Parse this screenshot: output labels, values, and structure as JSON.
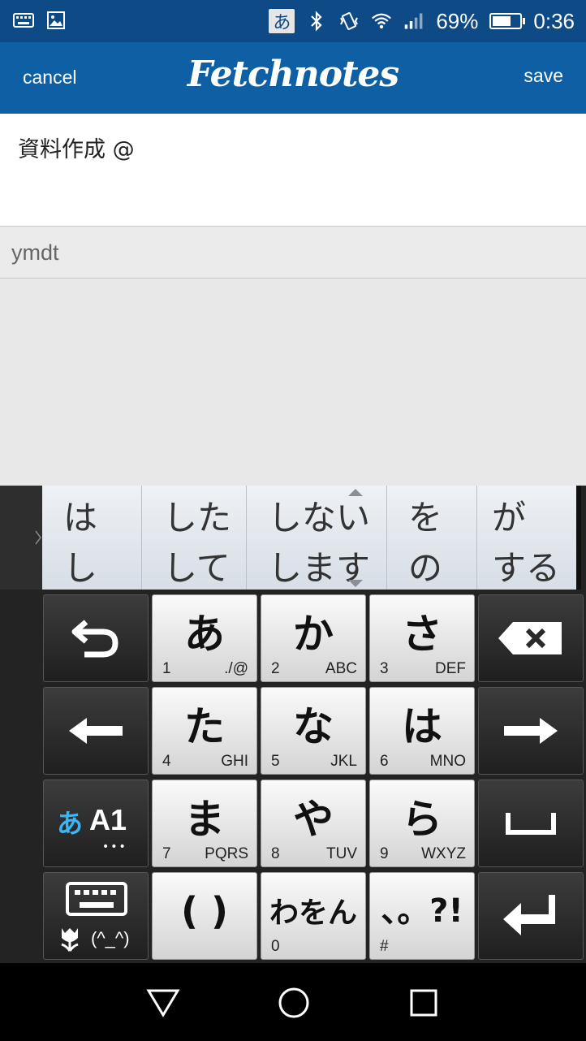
{
  "status_bar": {
    "icons_left": [
      "keyboard-icon",
      "image-icon"
    ],
    "ime_label": "あ",
    "icons_right": [
      "bluetooth-icon",
      "vibrate-icon",
      "wifi-icon",
      "signal-icon"
    ],
    "battery_percent": "69%",
    "battery_level": 0.69,
    "time": "0:36"
  },
  "header": {
    "cancel_label": "cancel",
    "logo": "Fetchnotes",
    "save_label": "save",
    "color": "#0e5fa4"
  },
  "note": {
    "text": "資料作成  @"
  },
  "tag_row": {
    "text": "ymdt"
  },
  "candidates": [
    {
      "top": "は",
      "bottom": "し"
    },
    {
      "top": "した",
      "bottom": "して"
    },
    {
      "top": "しない",
      "bottom": "します"
    },
    {
      "top": "を",
      "bottom": "の"
    },
    {
      "top": "が",
      "bottom": "する"
    }
  ],
  "keys": {
    "a": {
      "kana": "あ",
      "num": "1",
      "alpha": "./@"
    },
    "ka": {
      "kana": "か",
      "num": "2",
      "alpha": "ABC"
    },
    "sa": {
      "kana": "さ",
      "num": "3",
      "alpha": "DEF"
    },
    "ta": {
      "kana": "た",
      "num": "4",
      "alpha": "GHI"
    },
    "na": {
      "kana": "な",
      "num": "5",
      "alpha": "JKL"
    },
    "ha": {
      "kana": "は",
      "num": "6",
      "alpha": "MNO"
    },
    "ma": {
      "kana": "ま",
      "num": "7",
      "alpha": "PQRS"
    },
    "ya": {
      "kana": "や",
      "num": "8",
      "alpha": "TUV"
    },
    "ra": {
      "kana": "ら",
      "num": "9",
      "alpha": "WXYZ"
    },
    "paren": {
      "kana": "( )"
    },
    "wa": {
      "kana": "わをん",
      "num": "0"
    },
    "punct": {
      "kana": "、。?!",
      "num": "#"
    },
    "mode": {
      "label_kana": "あ",
      "label_alnum": "A1",
      "dots": "•••"
    },
    "emoticon": {
      "label": "(^_^)"
    }
  }
}
